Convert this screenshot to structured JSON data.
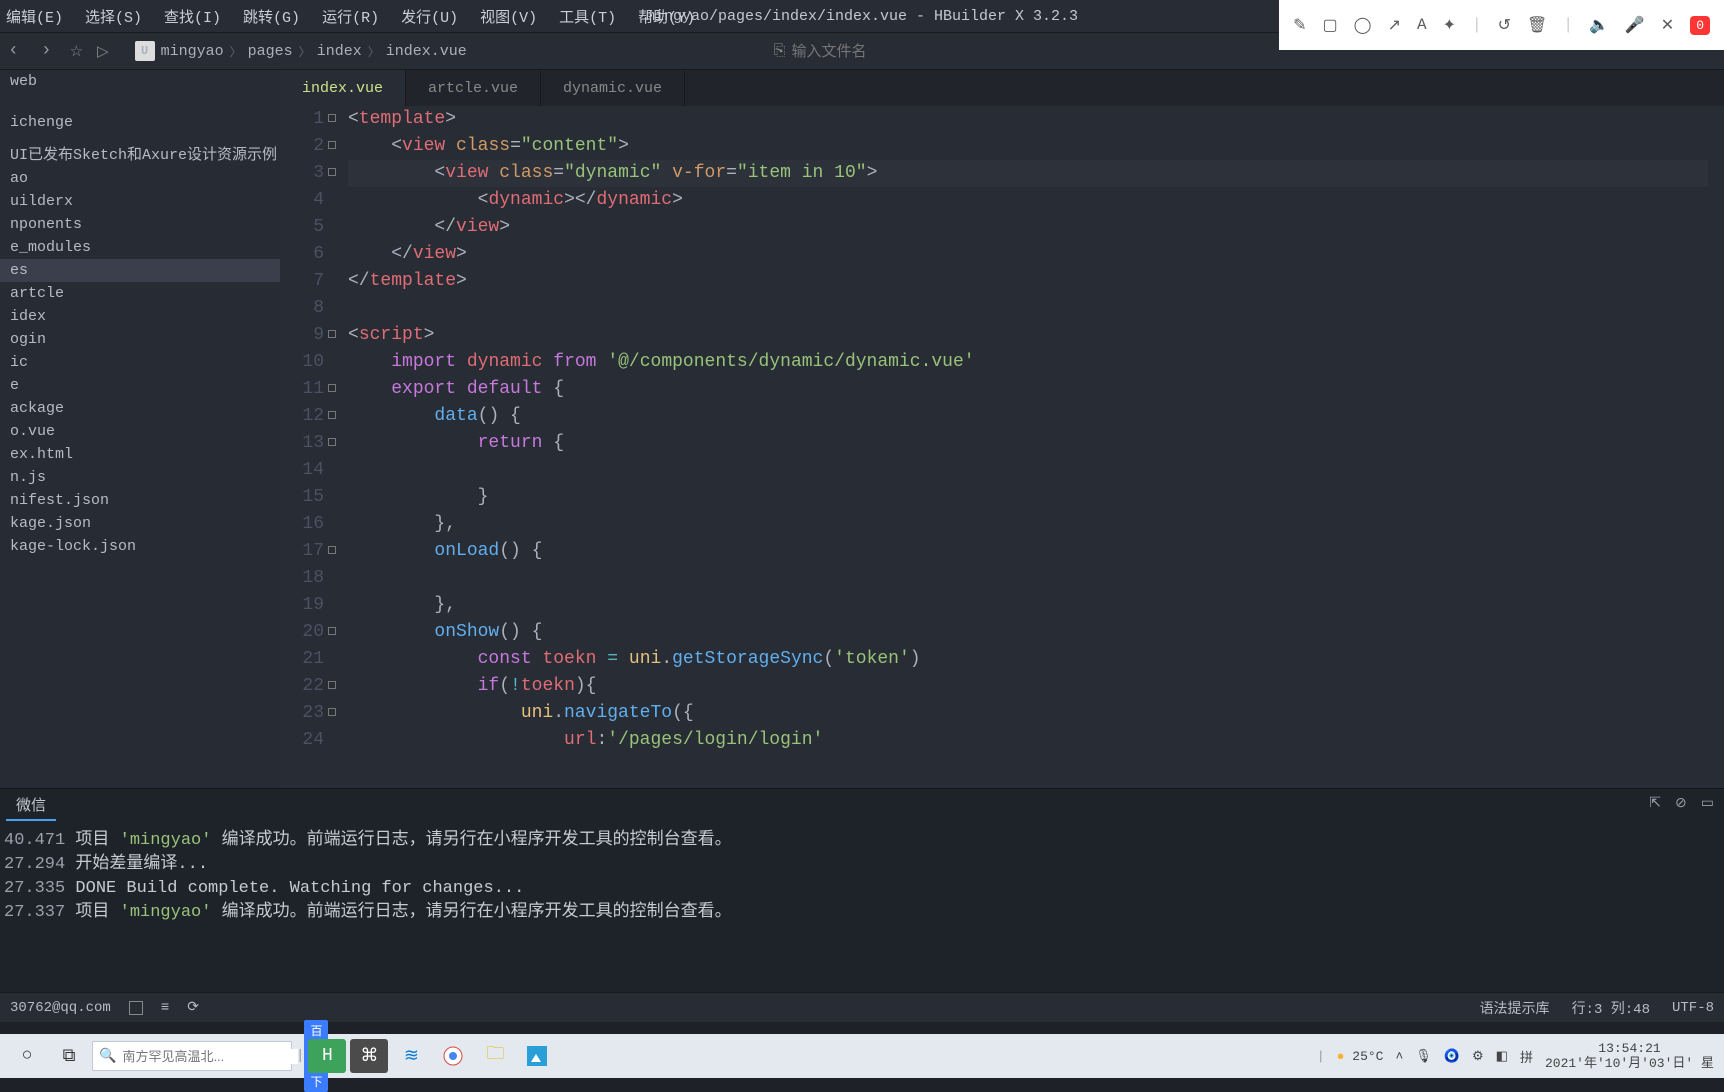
{
  "menu": {
    "items": [
      "编辑(E)",
      "选择(S)",
      "查找(I)",
      "跳转(G)",
      "运行(R)",
      "发行(U)",
      "视图(V)",
      "工具(T)",
      "帮助(Y)"
    ],
    "title": "mingyao/pages/index/index.vue - HBuilder X 3.2.3"
  },
  "recorder": {
    "badge": "0"
  },
  "nav": {
    "breadcrumb": [
      "mingyao",
      "pages",
      "index",
      "index.vue"
    ],
    "proj_label": "U",
    "search_placeholder": "输入文件名"
  },
  "sidebar": {
    "items": [
      "web",
      "",
      "",
      "",
      "ichenge",
      "",
      "UI已发布Sketch和Axure设计资源示例",
      "ao",
      "uilderx",
      "nponents",
      "e_modules",
      "es",
      "artcle",
      "idex",
      "ogin",
      "ic",
      "e",
      "ackage",
      "o.vue",
      "ex.html",
      "n.js",
      "nifest.json",
      "kage.json",
      "kage-lock.json"
    ],
    "selected_index": 11
  },
  "tabs": [
    {
      "label": "index.vue",
      "active": true
    },
    {
      "label": "artcle.vue",
      "active": false
    },
    {
      "label": "dynamic.vue",
      "active": false
    }
  ],
  "code": {
    "lines": [
      {
        "n": 1,
        "foldable": true,
        "tokens": [
          [
            "p",
            "<"
          ],
          [
            "tag",
            "template"
          ],
          [
            "p",
            ">"
          ]
        ]
      },
      {
        "n": 2,
        "foldable": true,
        "tokens": [
          [
            "p",
            "    <"
          ],
          [
            "tag",
            "view"
          ],
          [
            "p",
            " "
          ],
          [
            "attr",
            "class"
          ],
          [
            "p",
            "="
          ],
          [
            "str",
            "\"content\""
          ],
          [
            "p",
            ">"
          ]
        ]
      },
      {
        "n": 3,
        "foldable": true,
        "highlight": true,
        "tokens": [
          [
            "p",
            "        <"
          ],
          [
            "tag",
            "view"
          ],
          [
            "p",
            " "
          ],
          [
            "attr",
            "class"
          ],
          [
            "p",
            "="
          ],
          [
            "str",
            "\"dynamic\""
          ],
          [
            "p",
            " "
          ],
          [
            "attr",
            "v-for"
          ],
          [
            "p",
            "="
          ],
          [
            "str",
            "\"item in 10\""
          ],
          [
            "p",
            ">"
          ]
        ]
      },
      {
        "n": 4,
        "tokens": [
          [
            "p",
            "            <"
          ],
          [
            "tag",
            "dynamic"
          ],
          [
            "p",
            "></"
          ],
          [
            "tag",
            "dynamic"
          ],
          [
            "p",
            ">"
          ]
        ]
      },
      {
        "n": 5,
        "tokens": [
          [
            "p",
            "        </"
          ],
          [
            "tag",
            "view"
          ],
          [
            "p",
            ">"
          ]
        ]
      },
      {
        "n": 6,
        "tokens": [
          [
            "p",
            "    </"
          ],
          [
            "tag",
            "view"
          ],
          [
            "p",
            ">"
          ]
        ]
      },
      {
        "n": 7,
        "tokens": [
          [
            "p",
            "</"
          ],
          [
            "tag",
            "template"
          ],
          [
            "p",
            ">"
          ]
        ]
      },
      {
        "n": 8,
        "tokens": []
      },
      {
        "n": 9,
        "foldable": true,
        "tokens": [
          [
            "p",
            "<"
          ],
          [
            "tag",
            "script"
          ],
          [
            "p",
            ">"
          ]
        ]
      },
      {
        "n": 10,
        "tokens": [
          [
            "p",
            "    "
          ],
          [
            "kw",
            "import"
          ],
          [
            "p",
            " "
          ],
          [
            "var",
            "dynamic"
          ],
          [
            "p",
            " "
          ],
          [
            "kw",
            "from"
          ],
          [
            "p",
            " "
          ],
          [
            "str",
            "'@/components/dynamic/dynamic.vue'"
          ]
        ]
      },
      {
        "n": 11,
        "foldable": true,
        "tokens": [
          [
            "p",
            "    "
          ],
          [
            "kw",
            "export"
          ],
          [
            "p",
            " "
          ],
          [
            "kw",
            "default"
          ],
          [
            "p",
            " {"
          ]
        ]
      },
      {
        "n": 12,
        "foldable": true,
        "tokens": [
          [
            "p",
            "        "
          ],
          [
            "fn",
            "data"
          ],
          [
            "p",
            "() {"
          ]
        ]
      },
      {
        "n": 13,
        "foldable": true,
        "tokens": [
          [
            "p",
            "            "
          ],
          [
            "kw",
            "return"
          ],
          [
            "p",
            " {"
          ]
        ]
      },
      {
        "n": 14,
        "tokens": []
      },
      {
        "n": 15,
        "tokens": [
          [
            "p",
            "            }"
          ]
        ]
      },
      {
        "n": 16,
        "tokens": [
          [
            "p",
            "        },"
          ]
        ]
      },
      {
        "n": 17,
        "foldable": true,
        "tokens": [
          [
            "p",
            "        "
          ],
          [
            "fn",
            "onLoad"
          ],
          [
            "p",
            "() {"
          ]
        ]
      },
      {
        "n": 18,
        "tokens": []
      },
      {
        "n": 19,
        "tokens": [
          [
            "p",
            "        },"
          ]
        ]
      },
      {
        "n": 20,
        "foldable": true,
        "tokens": [
          [
            "p",
            "        "
          ],
          [
            "fn",
            "onShow"
          ],
          [
            "p",
            "() {"
          ]
        ]
      },
      {
        "n": 21,
        "tokens": [
          [
            "p",
            "            "
          ],
          [
            "kw",
            "const"
          ],
          [
            "p",
            " "
          ],
          [
            "var",
            "toekn"
          ],
          [
            "p",
            " "
          ],
          [
            "op",
            "="
          ],
          [
            "p",
            " "
          ],
          [
            "id",
            "uni"
          ],
          [
            "p",
            "."
          ],
          [
            "fn",
            "getStorageSync"
          ],
          [
            "p",
            "("
          ],
          [
            "str",
            "'token'"
          ],
          [
            "p",
            ")"
          ]
        ]
      },
      {
        "n": 22,
        "foldable": true,
        "tokens": [
          [
            "p",
            "            "
          ],
          [
            "kw",
            "if"
          ],
          [
            "p",
            "("
          ],
          [
            "op",
            "!"
          ],
          [
            "var",
            "toekn"
          ],
          [
            "p",
            "){"
          ]
        ]
      },
      {
        "n": 23,
        "foldable": true,
        "tokens": [
          [
            "p",
            "                "
          ],
          [
            "id",
            "uni"
          ],
          [
            "p",
            "."
          ],
          [
            "fn",
            "navigateTo"
          ],
          [
            "p",
            "({"
          ]
        ]
      },
      {
        "n": 24,
        "tokens": [
          [
            "p",
            "                    "
          ],
          [
            "var",
            "url"
          ],
          [
            "p",
            ":"
          ],
          [
            "str",
            "'/pages/login/login'"
          ]
        ]
      }
    ]
  },
  "console": {
    "tab_label": "微信",
    "lines": [
      {
        "time": "40.471",
        "segs": [
          [
            "p",
            "项目 "
          ],
          [
            "str",
            "'mingyao'"
          ],
          [
            "p",
            " 编译成功。前端运行日志，请另行在小程序开发工具的控制台查看。"
          ]
        ]
      },
      {
        "time": "27.294",
        "segs": [
          [
            "p",
            "开始差量编译..."
          ]
        ]
      },
      {
        "time": "27.335",
        "segs": [
          [
            "p",
            " DONE  Build complete. Watching for changes..."
          ]
        ]
      },
      {
        "time": "27.337",
        "segs": [
          [
            "p",
            "项目 "
          ],
          [
            "str",
            "'mingyao'"
          ],
          [
            "p",
            " 编译成功。前端运行日志，请另行在小程序开发工具的控制台查看。"
          ]
        ]
      }
    ]
  },
  "status": {
    "email": "30762@qq.com",
    "syntax": "语法提示库",
    "pos": "行:3  列:48",
    "encoding": "UTF-8"
  },
  "taskbar": {
    "search_placeholder": "南方罕见高温北...",
    "baidu": "百度一下",
    "weather": "25°C",
    "clock_time": "13:54:21",
    "clock_date": "2021'年'10'月'03'日' 星"
  }
}
